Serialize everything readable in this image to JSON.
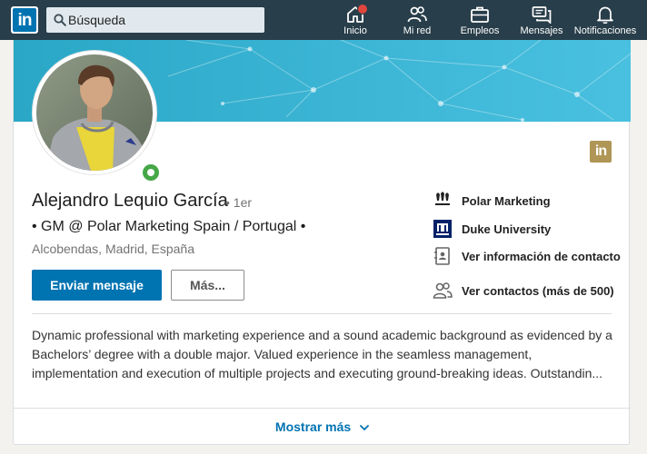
{
  "nav": {
    "logo": "in",
    "search": {
      "placeholder": "Búsqueda"
    },
    "items": [
      {
        "label": "Inicio",
        "icon": "home-icon",
        "badge": true
      },
      {
        "label": "Mi red",
        "icon": "my-network-icon"
      },
      {
        "label": "Empleos",
        "icon": "briefcase-icon"
      },
      {
        "label": "Mensajes",
        "icon": "messages-icon"
      },
      {
        "label": "Notificaciones",
        "icon": "bell-icon"
      }
    ]
  },
  "profile": {
    "name": "Alejandro Lequio García",
    "degree": "• 1er",
    "headline": "• GM @ Polar Marketing Spain / Portugal •",
    "location": "Alcobendas, Madrid, España",
    "buttons": {
      "message": "Enviar mensaje",
      "more": "Más..."
    },
    "brand_badge": "in",
    "side": [
      {
        "label": "Polar Marketing",
        "icon": "company-logo-icon"
      },
      {
        "label": "Duke University",
        "icon": "school-logo-icon"
      },
      {
        "label": "Ver información de contacto",
        "icon": "contact-card-icon"
      },
      {
        "label": "Ver contactos (más de 500)",
        "icon": "connections-icon"
      }
    ],
    "summary": [
      "Dynamic professional with marketing experience and a sound academic background as evidenced by a",
      "Bachelors’ degree with a double major. Valued experience in the seamless management,",
      "implementation and execution of multiple projects and executing ground-breaking ideas. Outstandin..."
    ],
    "show_more": "Mostrar más"
  },
  "colors": {
    "nav_bg": "#283e4a",
    "primary": "#0073b1",
    "banner": "#3bb4d4",
    "online": "#46a747",
    "badge": "#e0463d"
  }
}
